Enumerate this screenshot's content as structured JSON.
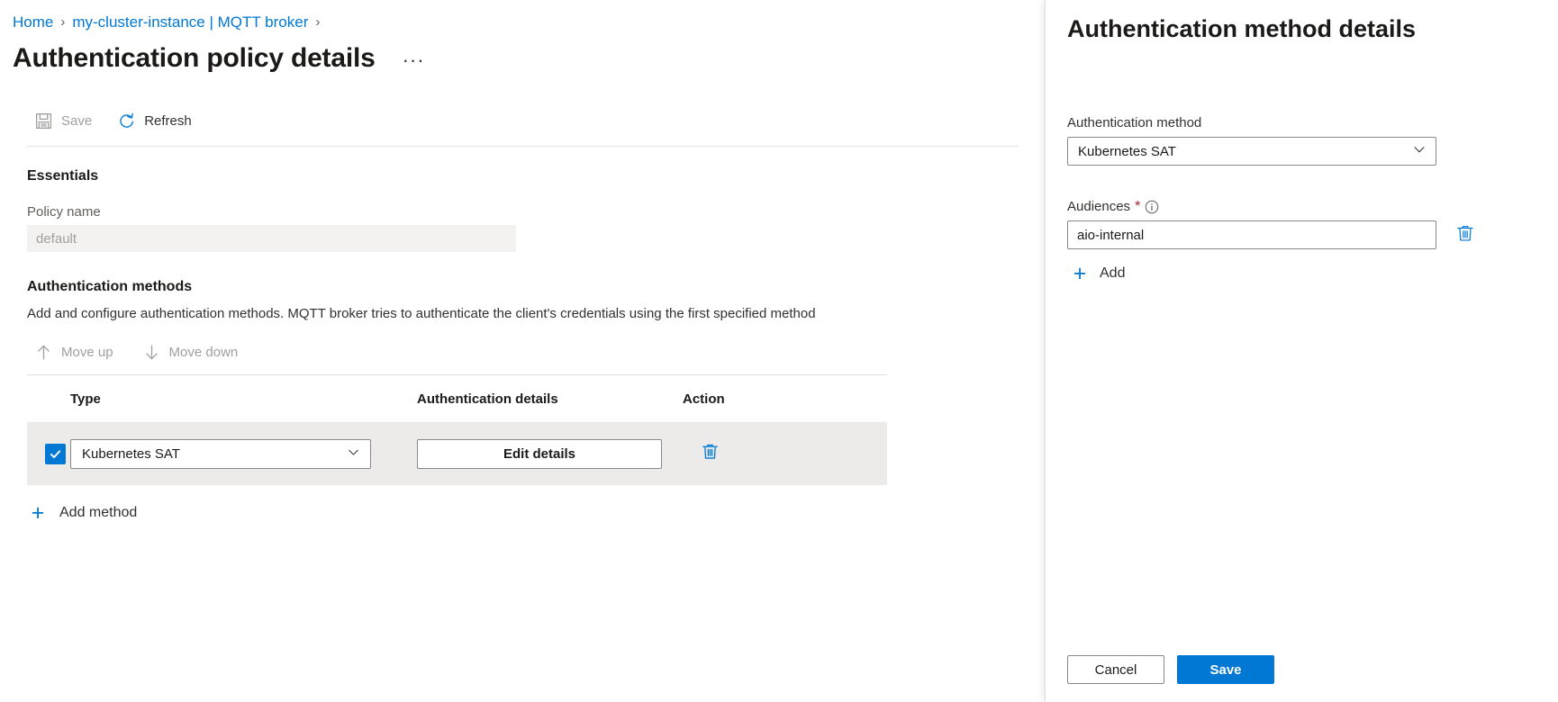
{
  "breadcrumb": {
    "items": [
      {
        "label": "Home",
        "separator": "›"
      },
      {
        "label": "my-cluster-instance | MQTT broker",
        "separator": "›"
      }
    ]
  },
  "header": {
    "title": "Authentication policy details",
    "more_menu": "···"
  },
  "toolbar": {
    "save_label": "Save",
    "save_enabled": false,
    "refresh_label": "Refresh",
    "refresh_enabled": true
  },
  "essentials": {
    "heading": "Essentials",
    "policy_name_label": "Policy name",
    "policy_name_value": "default"
  },
  "methods": {
    "heading": "Authentication methods",
    "description": "Add and configure authentication methods. MQTT broker tries to authenticate the client's credentials using the first specified method",
    "move_up_label": "Move up",
    "move_down_label": "Move down",
    "move_up_enabled": false,
    "move_down_enabled": false,
    "columns": [
      "",
      "Type",
      "Authentication details",
      "Action"
    ],
    "rows": [
      {
        "checked": true,
        "type": "Kubernetes SAT",
        "details_button": "Edit details",
        "action_icon": "trash-icon"
      }
    ],
    "add_method_label": "Add method"
  },
  "context_pane": {
    "title": "Authentication method details",
    "auth_method_label": "Authentication method",
    "auth_method_value": "Kubernetes SAT",
    "audiences_label": "Audiences",
    "audiences_required": "*",
    "audiences_info_icon": "info-icon",
    "audiences_value": "aio-internal",
    "audiences_placeholder": "",
    "audiences_delete_icon": "trash-icon",
    "add_label": "Add",
    "cancel_label": "Cancel",
    "save_label": "Save"
  },
  "colors": {
    "accent": "#0078d4",
    "link": "#0078d4",
    "required": "#a4262c",
    "row_background": "#edebe9",
    "disabled_text": "#a19f9d"
  }
}
